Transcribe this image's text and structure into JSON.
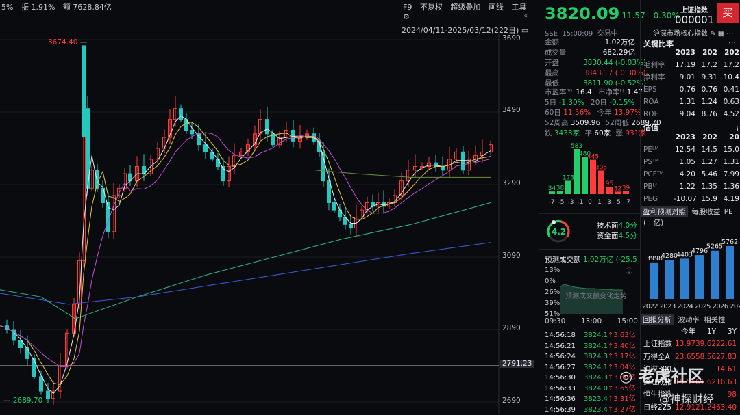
{
  "toolbar": {
    "amp": "5%",
    "amplitude": "振 1.91%",
    "turnover": "额 7628.84亿",
    "f9": "F9",
    "no_adjust": "不复权",
    "overlay": "超级叠加",
    "draw": "画线",
    "tools": "工具",
    "date_range": "2024/04/11-2025/03/12(222日)"
  },
  "chart": {
    "y_ticks": [
      "3690",
      "3490",
      "3290",
      "3090",
      "2890",
      "2690"
    ],
    "current_line": "2791.23",
    "high_label": "3674.40",
    "low_label": "2689.70"
  },
  "quote": {
    "price": "3820.09",
    "change": "-11.57",
    "change_pct": "-0.30%",
    "index_name": "上证指数",
    "code": "000001",
    "exchange": "SSE",
    "time": "15:00:09",
    "status": "交易中",
    "market_index": "沪深市场核心指数",
    "buy_label": "买",
    "stats": [
      {
        "label": "金额",
        "value": "1.02万亿",
        "color": "white"
      },
      {
        "label": "成交量",
        "value": "682.29亿",
        "color": "white"
      },
      {
        "label": "开盘",
        "value": "3830.44 (-0.03%)",
        "color": "green"
      },
      {
        "label": "最高",
        "value": "3843.17 ( 0.30%)",
        "color": "red"
      },
      {
        "label": "最低",
        "value": "3811.90 (-0.52%)",
        "color": "green"
      }
    ],
    "pe_label": "市盈率™",
    "pe_value": "16.4",
    "pb_label": "市净率ᴸᶠ",
    "pb_value": "1.47",
    "d5_label": "5日",
    "d5_value": "-1.30%",
    "d20_label": "20日",
    "d20_value": "-0.15%",
    "d60_label": "60日",
    "d60_value": "11.56%",
    "ytd_label": "今年",
    "ytd_value": "13.97%",
    "w52_hi_label": "52周高",
    "w52_hi_value": "3509.96",
    "w52_lo_label": "52周低",
    "w52_lo_value": "2689.70",
    "up_label": "跌",
    "up_count": "3433家",
    "flat_label": "平",
    "flat_count": "60家",
    "down_label": "涨",
    "down_count": "931家"
  },
  "distribution": {
    "bars": [
      {
        "x": "-7",
        "value": 34,
        "color": "#1fcf6a"
      },
      {
        "x": "-5",
        "value": 38,
        "color": "#1fcf6a"
      },
      {
        "x": "-3",
        "value": 173,
        "color": "#1fcf6a"
      },
      {
        "x": "-1",
        "value": 583,
        "color": "#1fcf6a"
      },
      {
        "x": "0",
        "value": 480,
        "color": "#1fcf6a"
      },
      {
        "x": "1",
        "value": 445,
        "color": "#ff3b3b"
      },
      {
        "x": "3",
        "value": 305,
        "color": "#ff3b3b"
      },
      {
        "x": "5",
        "value": 95,
        "color": "#ff3b3b"
      },
      {
        "x": "7",
        "value": 32,
        "color": "#ff3b3b"
      },
      {
        "x": "",
        "value": 39,
        "color": "#ff3b3b"
      }
    ],
    "x_labels": [
      "-7",
      "-5",
      "-3",
      "-1",
      "0",
      "1",
      "3",
      "5",
      "7"
    ]
  },
  "score": {
    "value": "4.2",
    "tech_label": "技术面",
    "tech_value": "4.0分",
    "fund_label": "资金面",
    "fund_value": "4.5分"
  },
  "forecast": {
    "label": "预测成交额",
    "value": "1.02万亿",
    "pct": "(-25.5",
    "scale": [
      "13%",
      "0%",
      "26%",
      "39%",
      "51%"
    ],
    "chart_label": "预测成交额变化走势",
    "times": [
      "09:30",
      "13:00",
      "15:00"
    ]
  },
  "ticks": [
    {
      "time": "14:56:18",
      "price": "3824.1",
      "vol": "3.63亿"
    },
    {
      "time": "14:56:21",
      "price": "3824.1",
      "vol": "3.40亿"
    },
    {
      "time": "14:56:24",
      "price": "3824.3",
      "vol": "3.17亿"
    },
    {
      "time": "14:56:27",
      "price": "3824.1",
      "vol": "3.04亿"
    },
    {
      "time": "14:56:30",
      "price": "3824.3",
      "vol": "3.30亿"
    },
    {
      "time": "14:56:33",
      "price": "3824.0",
      "vol": "3.65亿"
    },
    {
      "time": "14:56:36",
      "price": "3823.4",
      "vol": "3.31亿"
    },
    {
      "time": "14:56:39",
      "price": "3823.4",
      "vol": "3.27亿"
    }
  ],
  "ratios": {
    "title": "关键比率",
    "years": [
      "2023",
      "202",
      "202"
    ],
    "rows": [
      {
        "label": "毛利率",
        "v": [
          "17.19",
          "17.2",
          "17.2"
        ]
      },
      {
        "label": "净利率",
        "v": [
          "9.01",
          "9.31",
          "10.4"
        ]
      },
      {
        "label": "EPS",
        "v": [
          "0.76",
          "0.76",
          "0.41"
        ]
      },
      {
        "label": "ROA",
        "v": [
          "1.31",
          "1.24",
          "0.63"
        ]
      },
      {
        "label": "ROE",
        "v": [
          "9.04",
          "8.76",
          "4.52"
        ]
      }
    ]
  },
  "valuation": {
    "title": "估值",
    "years": [
      "2023",
      "202",
      "20"
    ],
    "rows": [
      {
        "label": "PEᴸᴹ",
        "v": [
          "12.54",
          "14.5",
          "15.0"
        ]
      },
      {
        "label": "PSᵀᴹ",
        "v": [
          "1.05",
          "1.27",
          "1.31"
        ]
      },
      {
        "label": "PCFᵀᴹ",
        "v": [
          "4.20",
          "5.46",
          "7.99"
        ]
      },
      {
        "label": "PBᴸᶠ",
        "v": [
          "1.22",
          "1.35",
          "1.36"
        ]
      },
      {
        "label": "PEG",
        "v": [
          "-10.07",
          "15.9",
          "4.19"
        ]
      }
    ]
  },
  "profit_forecast": {
    "tab_active": "盈利预测对照",
    "tab2": "每股收益",
    "tab3": "PE",
    "unit": "(十亿)",
    "bars": [
      {
        "year": "2022",
        "value": 3998
      },
      {
        "year": "2023",
        "value": 4280
      },
      {
        "year": "2024",
        "value": 4403
      },
      {
        "year": "2025",
        "value": 4796
      },
      {
        "year": "2026",
        "value": 5265
      },
      {
        "year": "2027E",
        "value": 5762
      }
    ],
    "x_labels": "2022 2023 2024 2025 2026 2027E"
  },
  "returns": {
    "tab_active": "回报分析",
    "tab2": "波动率",
    "tab3": "相关性",
    "cols": [
      "今年",
      "1Y",
      "3Y"
    ],
    "rows": [
      {
        "label": "上证指数",
        "v": [
          "13.97",
          "39.62",
          "22.61"
        ]
      },
      {
        "label": "万得全A",
        "v": [
          "23.65",
          "58.56",
          "27.83"
        ]
      },
      {
        "label": "沪深300",
        "v": [
          "",
          "",
          "14.61"
        ]
      },
      {
        "label": "深证成指",
        "v": [
          "15.51",
          "61.62",
          "16.63"
        ]
      },
      {
        "label": "恒生指数",
        "v": [
          "",
          "",
          "98"
        ]
      },
      {
        "label": "日经225",
        "v": [
          "12.91",
          "21.24",
          "63.40"
        ]
      }
    ]
  },
  "watermark": {
    "brand": "老虎社区",
    "handle": "@神探财经"
  }
}
